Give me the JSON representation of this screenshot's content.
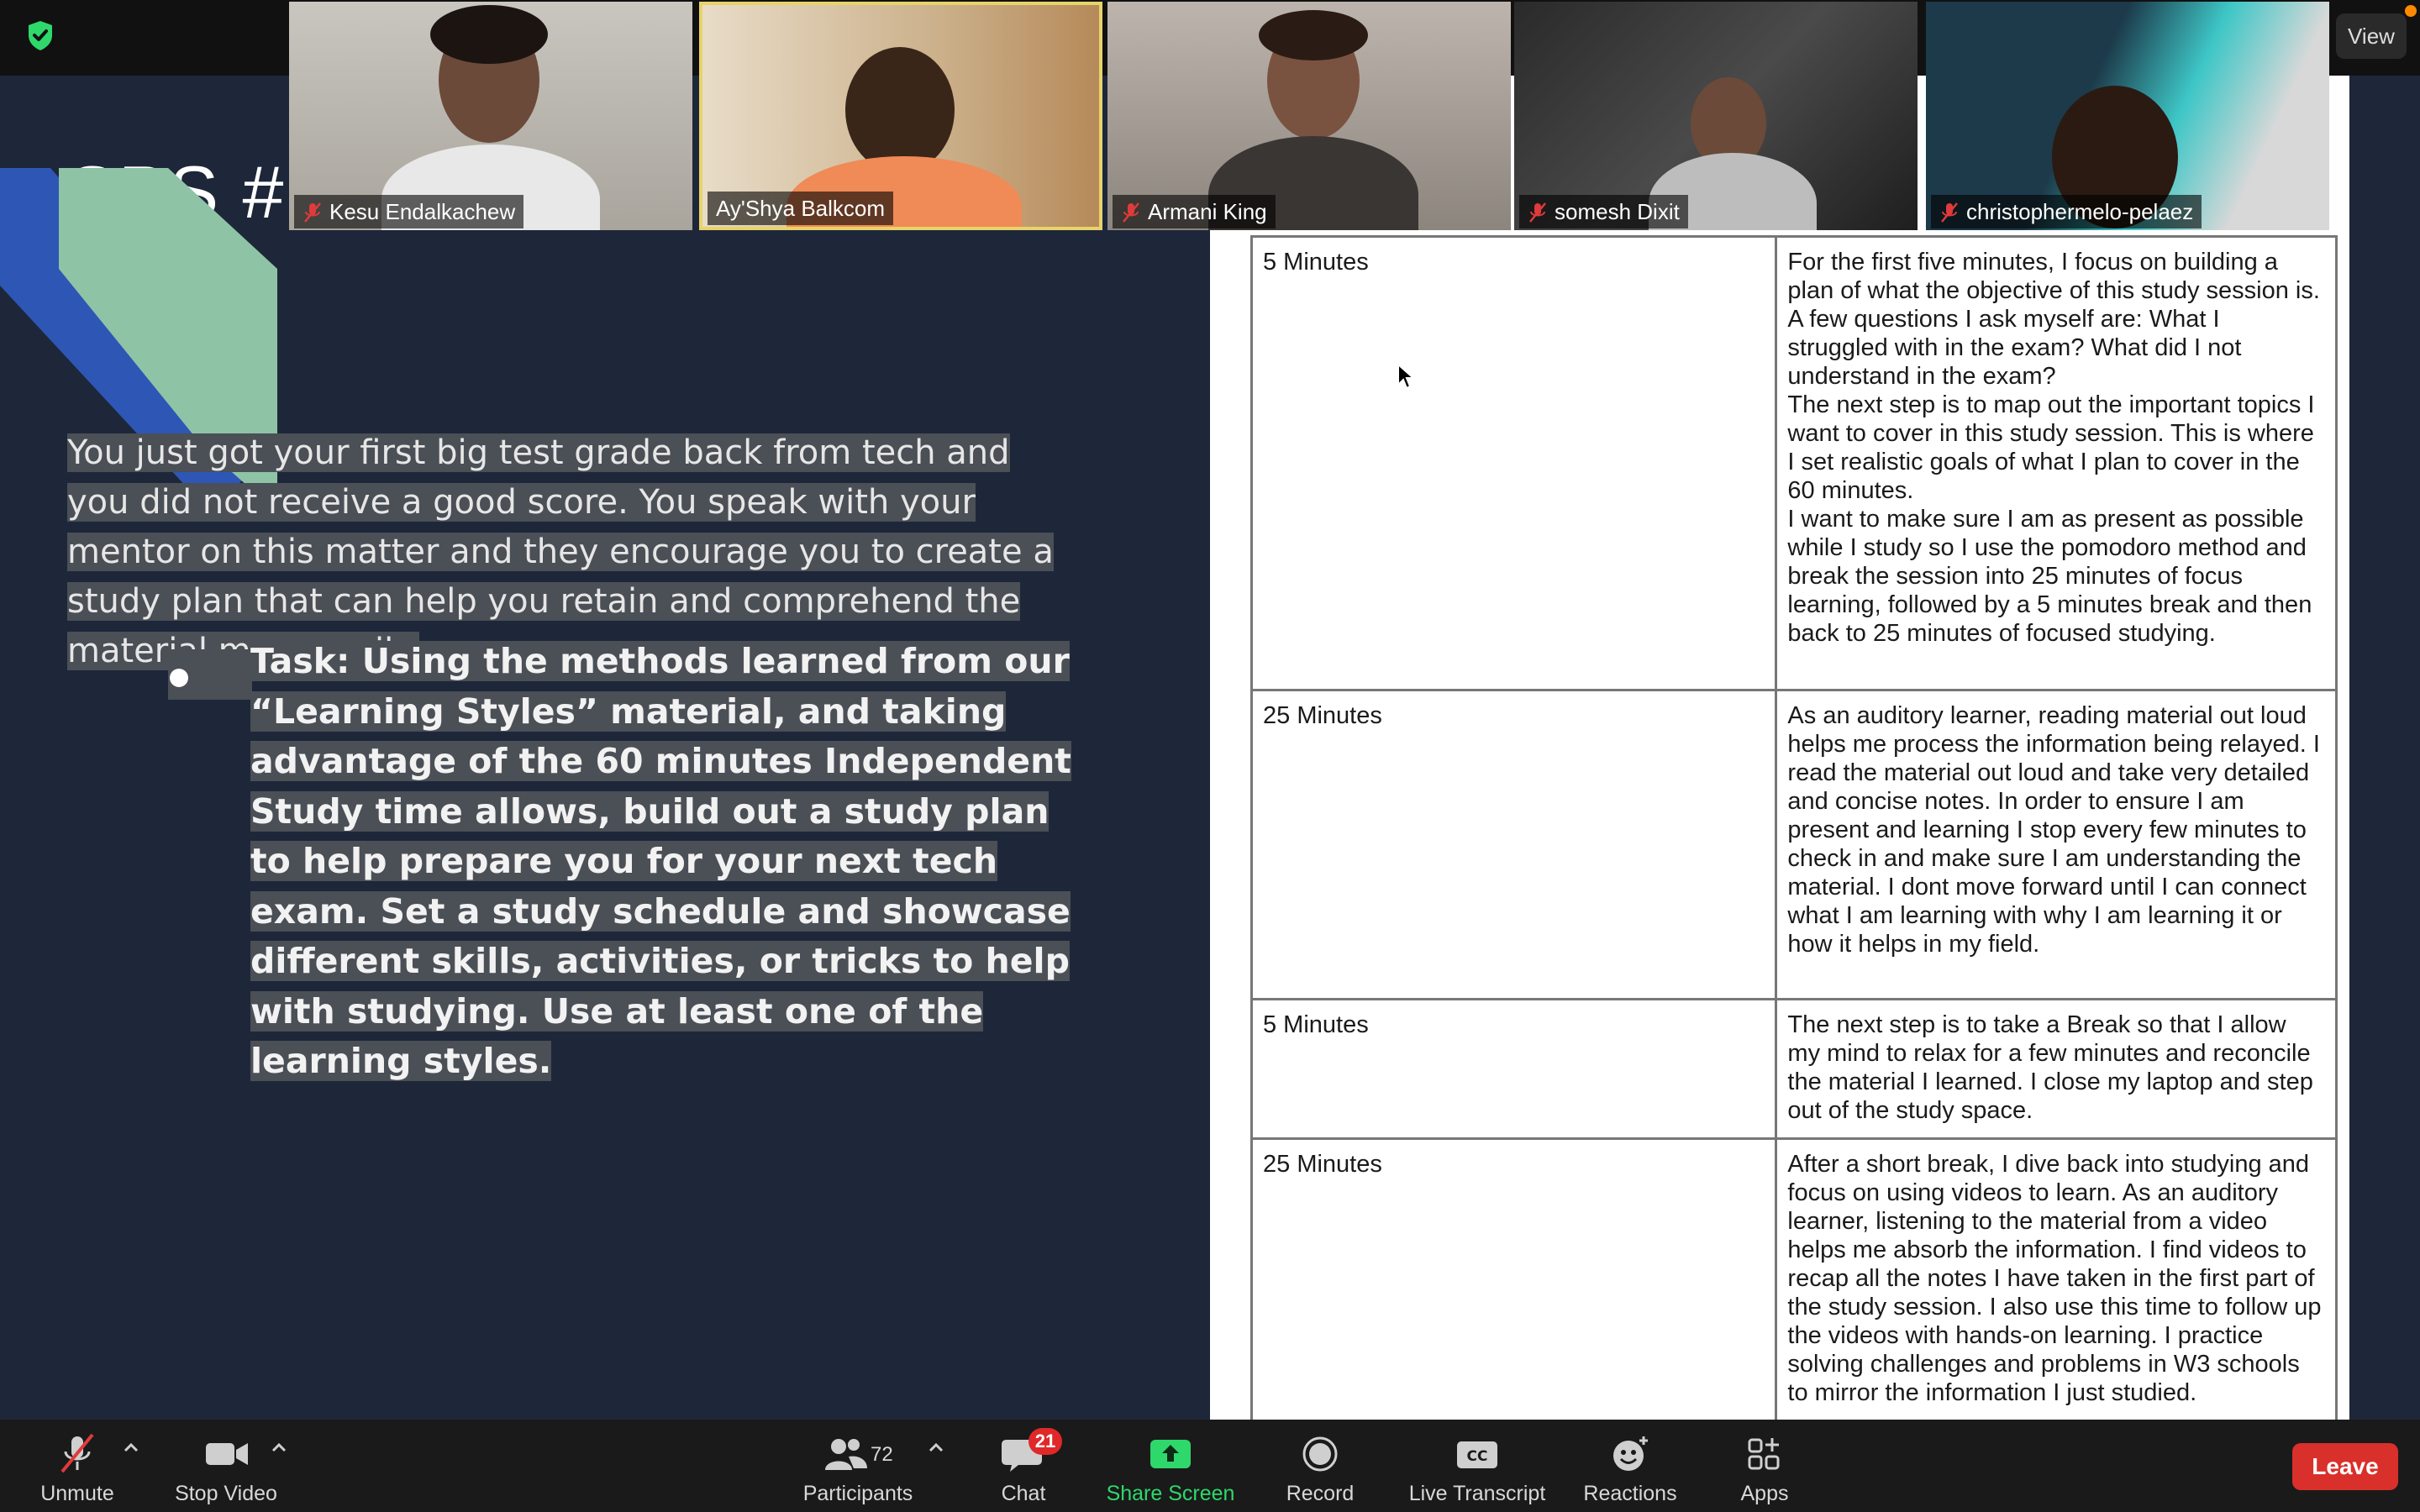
{
  "top_bar": {
    "view_label": "View",
    "shield_icon": "shield-check-icon",
    "accent_color": "#2fd86b"
  },
  "slide": {
    "title": "SPS #7",
    "paragraph": "You just got your first big test grade back from tech and you did not receive a good score. You speak with your mentor on this matter and they encourage you to create a study plan that can help you retain and comprehend the material more easily.",
    "task": "Task: Using the methods learned from our “Learning Styles” material, and taking advantage of the 60 minutes Independent Study time allows, build out a study plan to help prepare you for your next tech exam. Set a study schedule and showcase different skills, activities, or tricks to help with studying. Use at least one of the learning styles.",
    "stripe_colors": [
      "#2e56b5",
      "#8fc3a6"
    ]
  },
  "participants": [
    {
      "name": "Kesu Endalkachew",
      "muted": true
    },
    {
      "name": "Ay'Shya Balkcom",
      "muted": false,
      "speaking": true
    },
    {
      "name": "Armani King",
      "muted": true
    },
    {
      "name": "somesh Dixit",
      "muted": true
    },
    {
      "name": "christophermelo-pelaez",
      "muted": true
    }
  ],
  "doc_table": {
    "rows": [
      {
        "duration": "5 Minutes",
        "description": "For the first five minutes, I focus on building a plan of what the objective of this study session is. A few questions I ask myself are: What I struggled with in the exam? What did I not understand in the exam?\nThe next step is to map out the important topics I want to cover in this study session. This is where I set realistic goals of what I plan to cover in the 60 minutes.\nI want to make sure I am as present as possible while I study so I use the pomodoro method and break the session into 25 minutes of focus learning, followed by a 5 minutes break and then back to 25 minutes of focused studying."
      },
      {
        "duration": "25 Minutes",
        "description": "As an auditory learner, reading material out loud helps me process the information being relayed. I read the material out loud and take very detailed and concise notes. In order to ensure I am present and learning I stop every few minutes to check in and make sure I am understanding the material. I dont move forward until I can connect what I am learning with why I am learning it or how it helps in my field."
      },
      {
        "duration": "5 Minutes",
        "description": "The next step is to take a Break so that I allow my mind to relax for a few minutes and reconcile the material I learned. I close my laptop and step out of the study space."
      },
      {
        "duration": "25  Minutes",
        "description": "After a short break, I dive back into studying and focus on using videos to learn. As an auditory learner, listening to the material from a video helps me absorb the information. I find videos to recap all the notes I have taken in the first part of the study session. I also use this time to follow up the videos with hands-on learning. I practice solving challenges and problems in W3 schools to mirror the information I just studied."
      }
    ]
  },
  "toolbar": {
    "unmute": "Unmute",
    "stop_video": "Stop Video",
    "participants": "Participants",
    "participants_count": "72",
    "chat": "Chat",
    "chat_badge": "21",
    "share_screen": "Share Screen",
    "record": "Record",
    "live_transcript": "Live Transcript",
    "reactions": "Reactions",
    "apps": "Apps",
    "leave": "Leave",
    "leave_color": "#d9302b"
  }
}
